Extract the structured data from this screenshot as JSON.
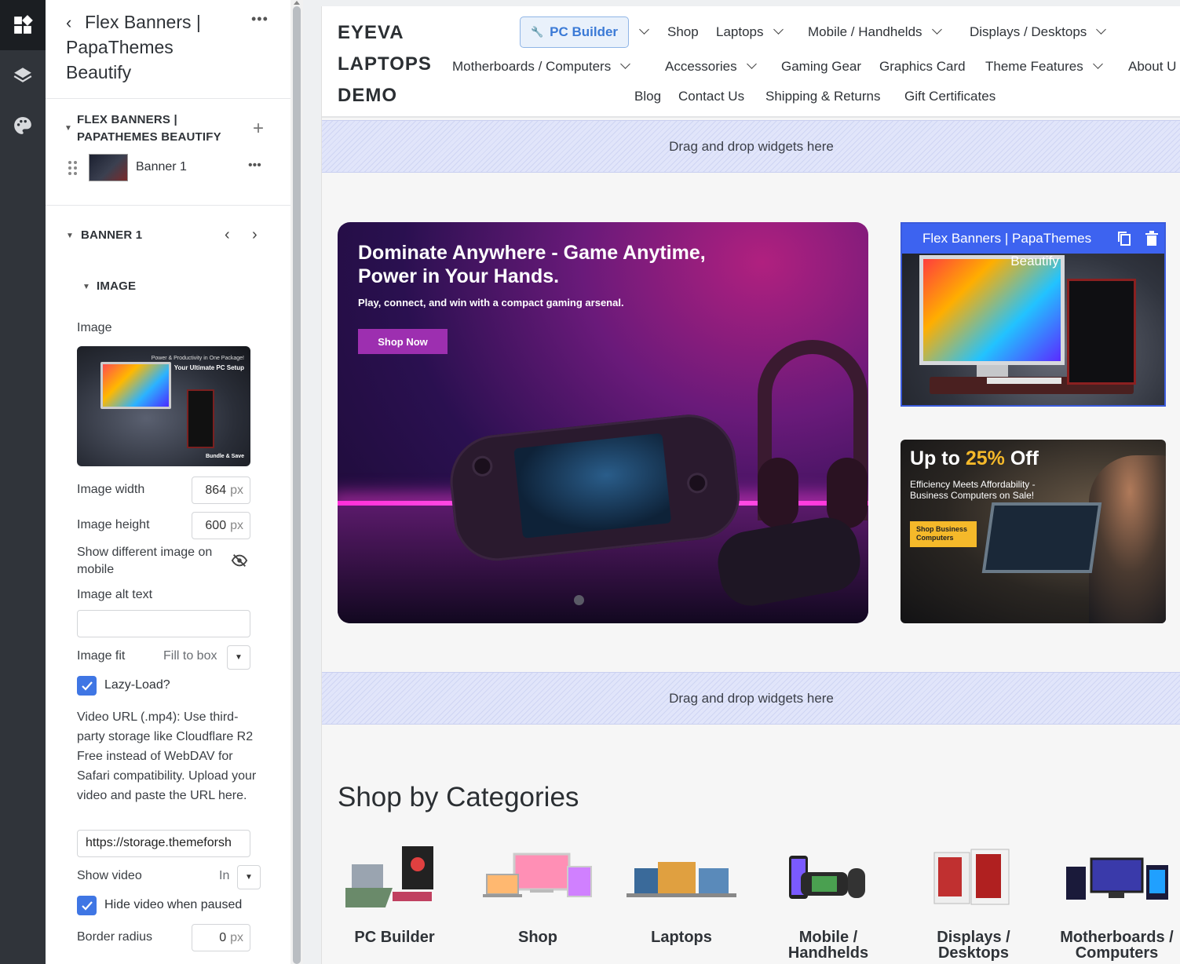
{
  "sidebar_panel": {
    "title": "Flex Banners | PapaThemes Beautify",
    "widget_section": "FLEX BANNERS | PAPATHEMES BEAUTIFY",
    "items": [
      {
        "label": "Banner 1"
      }
    ],
    "banner_section": "BANNER 1",
    "image_section": "IMAGE",
    "fields": {
      "image_label": "Image",
      "preview_line1": "Power & Productivity in One Package!",
      "preview_line2": "Your Ultimate PC Setup",
      "preview_line3": "Bundle & Save",
      "image_width_label": "Image width",
      "image_width_value": "864",
      "image_height_label": "Image height",
      "image_height_value": "600",
      "unit": "px",
      "show_mobile_label": "Show different image on mobile",
      "alt_label": "Image alt text",
      "alt_value": "",
      "fit_label": "Image fit",
      "fit_value": "Fill to box",
      "lazy_label": "Lazy-Load?",
      "lazy_checked": true,
      "video_desc": "Video URL (.mp4): Use third-party storage like Cloudflare R2 Free instead of WebDAV for Safari compatibility. Upload your video and paste the URL here.",
      "video_url": "https://storage.themeforsh",
      "show_video_label": "Show video",
      "show_video_value": "In",
      "hide_video_label": "Hide video when paused",
      "hide_video_checked": true,
      "border_radius_label": "Border radius",
      "border_radius_value": "0"
    }
  },
  "store": {
    "logo": "EYEVA LAPTOPS DEMO",
    "nav_featured": "PC Builder",
    "nav": [
      "Shop",
      "Laptops",
      "Mobile / Handhelds",
      "Displays / Desktops",
      "Motherboards / Computers",
      "Accessories",
      "Gaming Gear",
      "Graphics Card",
      "Theme Features",
      "About U",
      "Blog",
      "Contact Us",
      "Shipping & Returns",
      "Gift Certificates"
    ],
    "dropzone_text": "Drag and drop widgets here",
    "hero": {
      "title": "Dominate Anywhere - Game Anytime, Power in Your Hands.",
      "subtitle": "Play, connect, and win with a compact gaming arsenal.",
      "button": "Shop Now"
    },
    "side_banner_1": {
      "widget_label": "Flex Banners | PapaThemes",
      "widget_label_2": "Beautify"
    },
    "side_banner_2": {
      "title_prefix": "Up to ",
      "title_accent": "25%",
      "title_suffix": " Off",
      "subtitle": "Efficiency Meets Affordability - Business Computers on Sale!",
      "button": "Shop Business Computers"
    },
    "categories_title": "Shop by Categories",
    "categories": [
      "PC Builder",
      "Shop",
      "Laptops",
      "Mobile / Handhelds",
      "Displays / Desktops",
      "Motherboards / Computers"
    ]
  },
  "colors": {
    "rail": "#30343a",
    "accent": "#3f76e4",
    "widget_blue": "#3d63f0",
    "hero_button": "#9d2fb0",
    "sale_accent": "#f5b92a"
  }
}
